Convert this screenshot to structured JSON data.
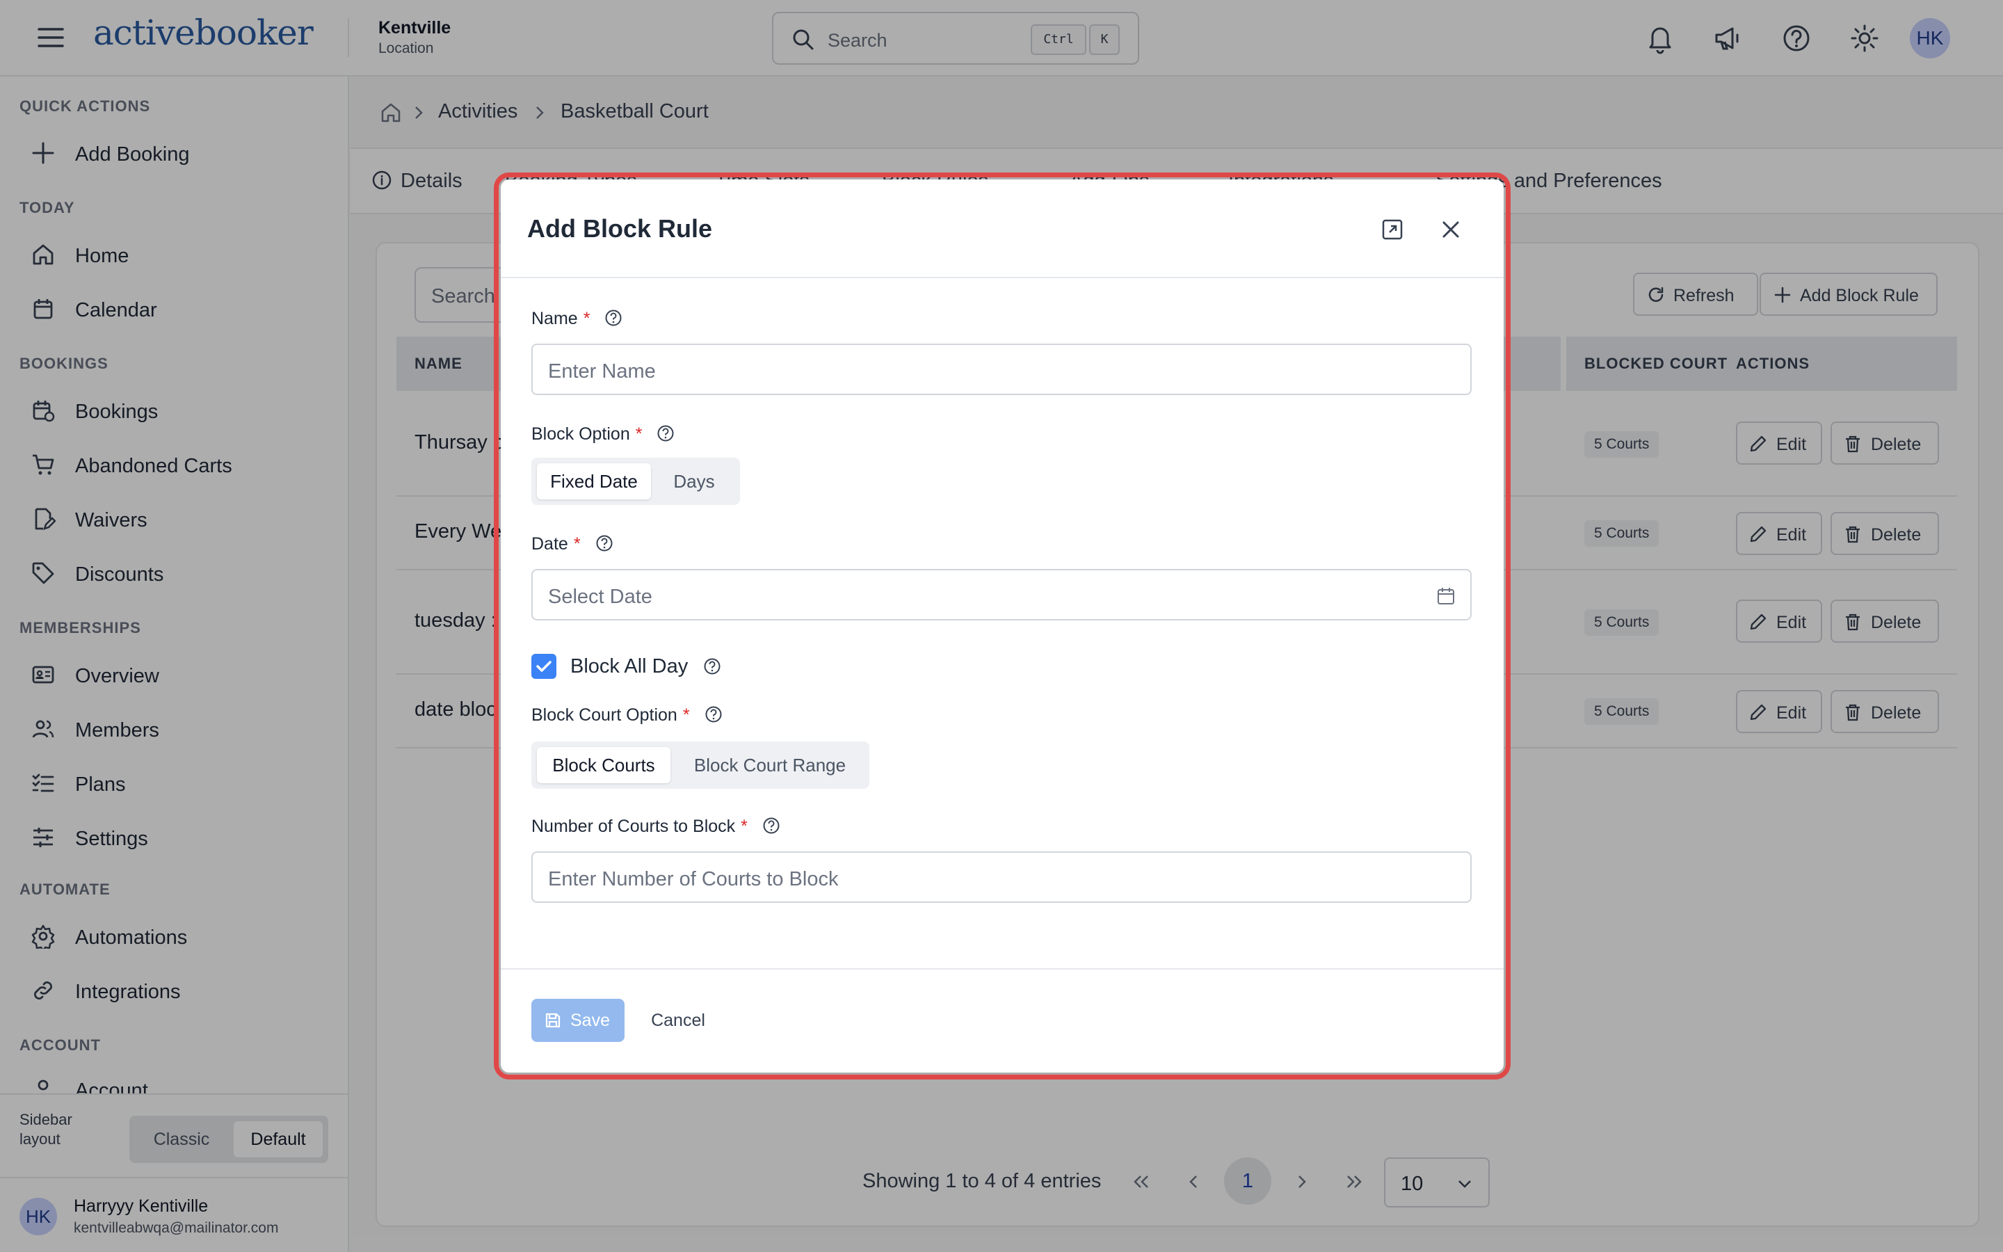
{
  "app": {
    "logo": "activebooker"
  },
  "location": {
    "name": "Kentville",
    "label": "Location"
  },
  "search": {
    "placeholder": "Search",
    "shortcut_ctrl": "Ctrl",
    "shortcut_key": "K"
  },
  "header": {
    "avatar_initials": "HK"
  },
  "sidebar": {
    "quick_actions_heading": "QUICK ACTIONS",
    "add_booking": "Add Booking",
    "today_heading": "TODAY",
    "home": "Home",
    "calendar": "Calendar",
    "bookings_heading": "BOOKINGS",
    "bookings": "Bookings",
    "abandoned_carts": "Abandoned Carts",
    "waivers": "Waivers",
    "discounts": "Discounts",
    "memberships_heading": "MEMBERSHIPS",
    "overview": "Overview",
    "members": "Members",
    "plans": "Plans",
    "settings": "Settings",
    "automate_heading": "AUTOMATE",
    "automations": "Automations",
    "integrations": "Integrations",
    "account_heading": "ACCOUNT",
    "account": "Account",
    "layout_label": "Sidebar layout",
    "layout_classic": "Classic",
    "layout_default": "Default",
    "user_initials": "HK",
    "user_name": "Harryyy Kentiville",
    "user_email": "kentvilleabwqa@mailinator.com"
  },
  "breadcrumb": {
    "activities": "Activities",
    "current": "Basketball Court"
  },
  "tabs": {
    "details": "Details",
    "booking_types": "Booking Types",
    "time_slots": "Time Slots",
    "block_rules": "Block Rules",
    "add_ons": "Add-Ons",
    "integrations": "Integrations",
    "settings": "Settings and Preferences"
  },
  "table": {
    "search_placeholder": "Search",
    "refresh": "Refresh",
    "add_block_rule": "Add Block Rule",
    "columns": {
      "name": "NAME",
      "blocked_court": "BLOCKED COURT",
      "actions": "ACTIONS"
    },
    "rows": [
      {
        "name": "Thursay b",
        "blocked": "5 Courts"
      },
      {
        "name": "Every We",
        "blocked": "5 Courts"
      },
      {
        "name": "tuesday :",
        "blocked": "5 Courts"
      },
      {
        "name": "date bloc",
        "blocked": "5 Courts"
      }
    ],
    "edit": "Edit",
    "delete": "Delete"
  },
  "pagination": {
    "summary": "Showing 1 to 4 of 4 entries",
    "current_page": "1",
    "page_size": "10"
  },
  "modal": {
    "title": "Add Block Rule",
    "name_label": "Name",
    "name_placeholder": "Enter Name",
    "block_option_label": "Block Option",
    "block_option_fixed": "Fixed Date",
    "block_option_days": "Days",
    "date_label": "Date",
    "date_placeholder": "Select Date",
    "block_all_day_label": "Block All Day",
    "block_all_day_checked": true,
    "court_option_label": "Block Court Option",
    "court_option_courts": "Block Courts",
    "court_option_range": "Block Court Range",
    "courts_count_label": "Number of Courts to Block",
    "courts_count_placeholder": "Enter Number of Courts to Block",
    "required_mark": "*",
    "save": "Save",
    "cancel": "Cancel"
  },
  "colors": {
    "brand": "#2a5b9f",
    "accent": "#3b82f6",
    "highlight": "#e04848",
    "required": "#dc2626"
  }
}
